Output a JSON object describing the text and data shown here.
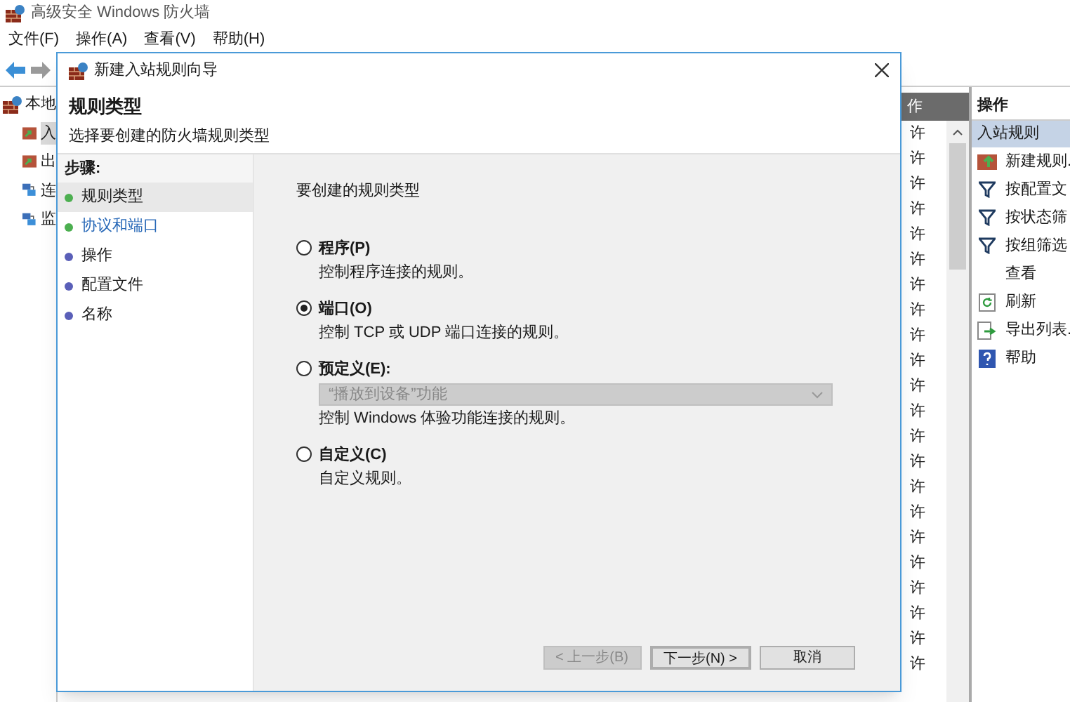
{
  "app": {
    "title": "高级安全 Windows 防火墙",
    "menu": [
      "文件(F)",
      "操作(A)",
      "查看(V)",
      "帮助(H)"
    ]
  },
  "tree": {
    "root": "本地",
    "children": [
      {
        "label": "入",
        "selected": true
      },
      {
        "label": "出",
        "selected": false
      },
      {
        "label": "连",
        "selected": false
      },
      {
        "label": "监",
        "selected": false
      }
    ]
  },
  "rules_table": {
    "column_header": "作",
    "cells": [
      "许",
      "许",
      "许",
      "许",
      "许",
      "许",
      "许",
      "许",
      "许",
      "许",
      "许",
      "许",
      "许",
      "许",
      "许",
      "许",
      "许",
      "许",
      "许",
      "许",
      "许",
      "许"
    ]
  },
  "actions_pane": {
    "title": "操作",
    "section": "入站规则",
    "items": [
      {
        "kind": "new",
        "label": "新建规则."
      },
      {
        "kind": "filter",
        "label": "按配置文"
      },
      {
        "kind": "filter",
        "label": "按状态筛"
      },
      {
        "kind": "filter",
        "label": "按组筛选"
      },
      {
        "kind": "none",
        "label": "查看"
      },
      {
        "kind": "refresh",
        "label": "刷新"
      },
      {
        "kind": "export",
        "label": "导出列表."
      },
      {
        "kind": "help",
        "label": "帮助"
      }
    ]
  },
  "dialog": {
    "title": "新建入站规则向导",
    "heading": "规则类型",
    "subheading": "选择要创建的防火墙规则类型",
    "steps_title": "步骤:",
    "steps": [
      {
        "label": "规则类型",
        "kind": "done",
        "selected": true
      },
      {
        "label": "协议和端口",
        "kind": "next",
        "selected": false
      },
      {
        "label": "操作",
        "kind": "pending",
        "selected": false
      },
      {
        "label": "配置文件",
        "kind": "pending",
        "selected": false
      },
      {
        "label": "名称",
        "kind": "pending",
        "selected": false
      }
    ],
    "prompt": "要创建的规则类型",
    "options": [
      {
        "label": "程序(P)",
        "description": "控制程序连接的规则。",
        "selected": false
      },
      {
        "label": "端口(O)",
        "description": "控制 TCP 或 UDP 端口连接的规则。",
        "selected": true
      },
      {
        "label": "预定义(E):",
        "dropdown": {
          "value": "“播放到设备”功能",
          "disabled": true
        },
        "description": "控制 Windows 体验功能连接的规则。",
        "selected": false
      },
      {
        "label": "自定义(C)",
        "description": "自定义规则。",
        "selected": false
      }
    ],
    "buttons": [
      {
        "label": "< 上一步(B)",
        "disabled": true,
        "default": false
      },
      {
        "label": "下一步(N) >",
        "disabled": false,
        "default": true
      },
      {
        "label": "取消",
        "disabled": false,
        "default": false
      }
    ]
  }
}
